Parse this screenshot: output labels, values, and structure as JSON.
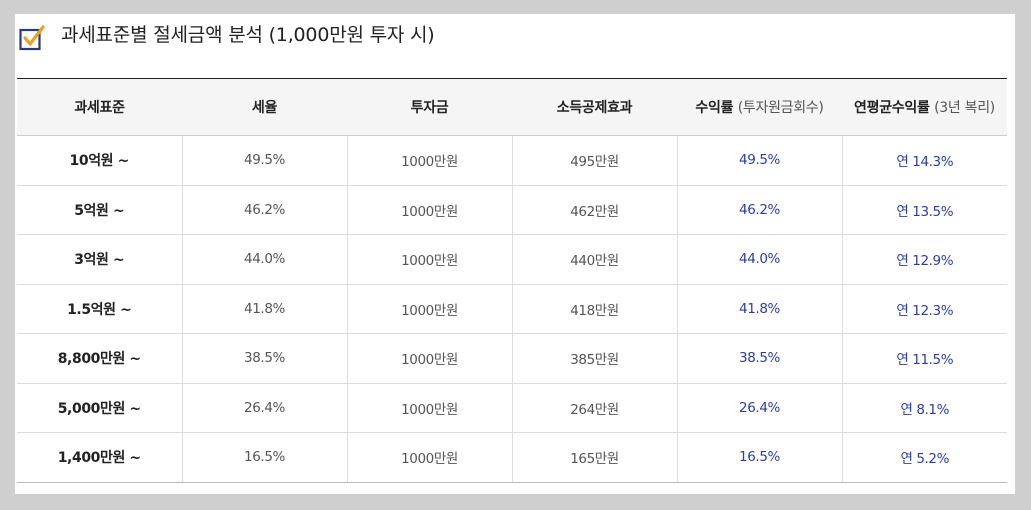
{
  "title": "과세표준별 절세금액 분석 (1,000만원 투자 시)",
  "icon": "checkbox-check-icon",
  "colors": {
    "accent_blue": "#2b3ea8",
    "check_orange": "#f0a020",
    "box_navy": "#2a3a7a"
  },
  "table": {
    "headers": {
      "c0": "과세표준",
      "c1": "세율",
      "c2": "투자금",
      "c3": "소득공제효과",
      "c4": "수익률",
      "c4_sub": "(투자원금회수)",
      "c5": "연평균수익률",
      "c5_sub": "(3년 복리)"
    },
    "rows": [
      {
        "bracket": "10억원 ~",
        "rate": "49.5%",
        "invest": "1000만원",
        "deduction": "495만원",
        "return": "49.5%",
        "annual": "연 14.3%"
      },
      {
        "bracket": "5억원 ~",
        "rate": "46.2%",
        "invest": "1000만원",
        "deduction": "462만원",
        "return": "46.2%",
        "annual": "연 13.5%"
      },
      {
        "bracket": "3억원 ~",
        "rate": "44.0%",
        "invest": "1000만원",
        "deduction": "440만원",
        "return": "44.0%",
        "annual": "연 12.9%"
      },
      {
        "bracket": "1.5억원 ~",
        "rate": "41.8%",
        "invest": "1000만원",
        "deduction": "418만원",
        "return": "41.8%",
        "annual": "연 12.3%"
      },
      {
        "bracket": "8,800만원 ~",
        "rate": "38.5%",
        "invest": "1000만원",
        "deduction": "385만원",
        "return": "38.5%",
        "annual": "연 11.5%"
      },
      {
        "bracket": "5,000만원 ~",
        "rate": "26.4%",
        "invest": "1000만원",
        "deduction": "264만원",
        "return": "26.4%",
        "annual": "연 8.1%"
      },
      {
        "bracket": "1,400만원 ~",
        "rate": "16.5%",
        "invest": "1000만원",
        "deduction": "165만원",
        "return": "16.5%",
        "annual": "연 5.2%"
      }
    ]
  }
}
